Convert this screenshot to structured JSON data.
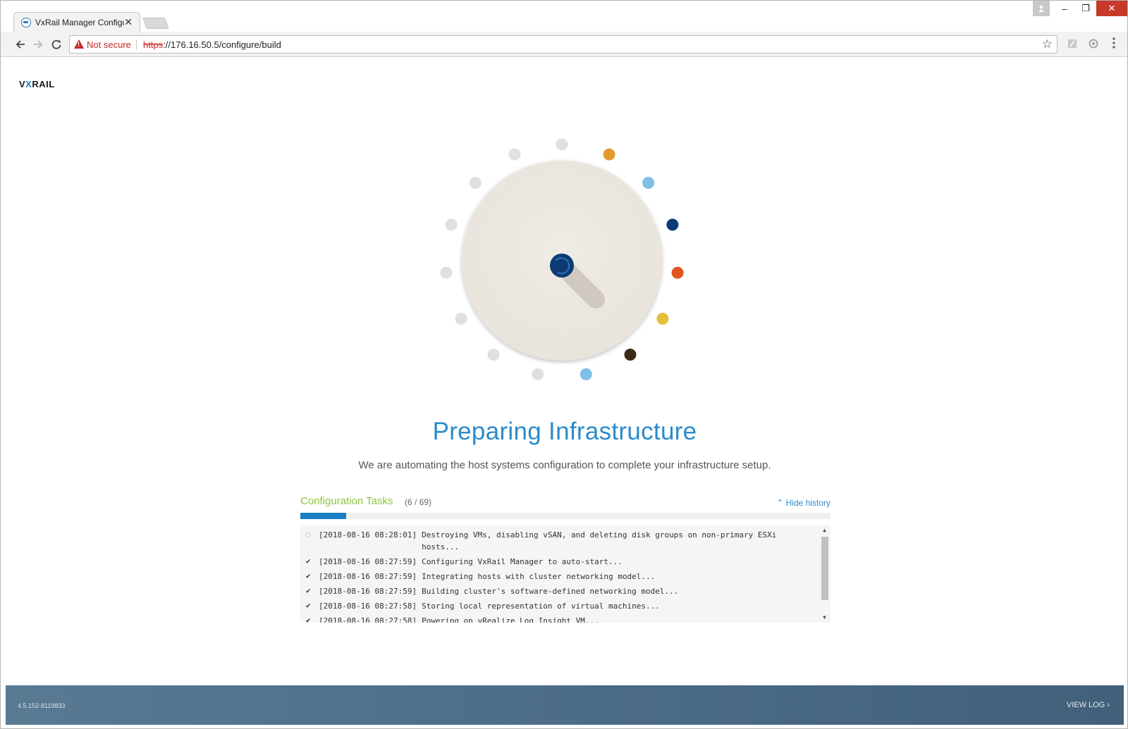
{
  "browser": {
    "tab_title": "VxRail Manager Configur",
    "tab_close": "✕",
    "security_label": "Not secure",
    "url_scheme": "https",
    "url_rest": "://176.16.50.5/configure/build",
    "icons": [
      "back-icon",
      "forward-icon",
      "reload-icon",
      "warning-icon",
      "star-icon",
      "pdf-extension-icon",
      "extension-icon",
      "menu-icon"
    ]
  },
  "window_controls": {
    "minimize": "–",
    "maximize": "❐",
    "close": "✕",
    "user": "👤"
  },
  "logo": {
    "prefix": "V",
    "x": "X",
    "suffix": "RAIL"
  },
  "spinner": {
    "dial_color": "#eee9e2",
    "center_color": "#0c3a74",
    "dots": [
      {
        "color": "#e0e0e0"
      },
      {
        "color": "#e39a2d"
      },
      {
        "color": "#7dc1e6"
      },
      {
        "color": "#0c3a74"
      },
      {
        "color": "#e0561e"
      },
      {
        "color": "#e2c03b"
      },
      {
        "color": "#3d2a14"
      },
      {
        "color": "#7dc1e6"
      },
      {
        "color": "#e0e0e0"
      },
      {
        "color": "#e0e0e0"
      },
      {
        "color": "#e0e0e0"
      },
      {
        "color": "#e0e0e0"
      },
      {
        "color": "#e0e0e0"
      },
      {
        "color": "#e0e0e0"
      },
      {
        "color": "#e0e0e0"
      }
    ]
  },
  "main": {
    "title": "Preparing Infrastructure",
    "subtitle": "We are automating the host systems configuration to complete your infrastructure setup."
  },
  "tasks": {
    "title": "Configuration Tasks",
    "count": "(6 / 69)",
    "completed": 6,
    "total": 69,
    "hide_history": "Hide history",
    "progress_color": "#1b7fc4",
    "log": [
      {
        "status": "pending",
        "timestamp": "[2018-08-16 08:28:01]",
        "message": "Destroying VMs, disabling vSAN, and deleting disk groups on non-primary ESXi hosts..."
      },
      {
        "status": "done",
        "timestamp": "[2018-08-16 08:27:59]",
        "message": "Configuring VxRail Manager to auto-start..."
      },
      {
        "status": "done",
        "timestamp": "[2018-08-16 08:27:59]",
        "message": "Integrating hosts with cluster networking model..."
      },
      {
        "status": "done",
        "timestamp": "[2018-08-16 08:27:59]",
        "message": "Building cluster's software-defined networking model..."
      },
      {
        "status": "done",
        "timestamp": "[2018-08-16 08:27:58]",
        "message": "Storing local representation of virtual machines..."
      },
      {
        "status": "done",
        "timestamp": "[2018-08-16 08:27:58]",
        "message": "Powering on vRealize Log Insight VM..."
      }
    ]
  },
  "footer": {
    "version": "4.5.152-8119833",
    "view_log": "VIEW LOG ›"
  }
}
